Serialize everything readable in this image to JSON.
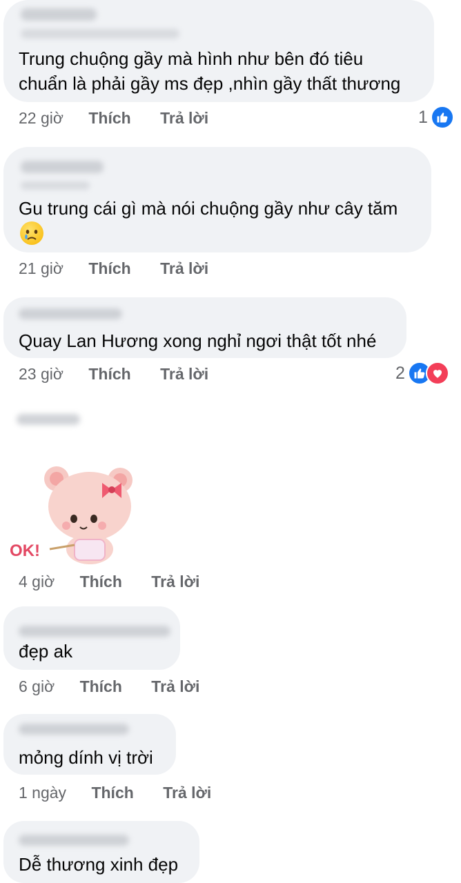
{
  "comments": [
    {
      "text_lines": [
        "Trung chuộng gầy mà hình như bên đó tiêu",
        "chuẩn là phải gầy ms đẹp ,nhìn gầy thất thương"
      ],
      "time": "22 giờ",
      "like_label": "Thích",
      "reply_label": "Trả lời",
      "reaction_count": "1",
      "reactions": [
        "like-icon"
      ]
    },
    {
      "text_lines": [
        "Gu trung cái gì mà nói chuộng gầy như cây tăm"
      ],
      "emoji": "crying-face-emoji",
      "time": "21 giờ",
      "like_label": "Thích",
      "reply_label": "Trả lời"
    },
    {
      "text_lines": [
        "Quay Lan Hương xong nghỉ ngơi thật tốt nhé"
      ],
      "time": "23 giờ",
      "like_label": "Thích",
      "reply_label": "Trả lời",
      "reaction_count": "2",
      "reactions": [
        "like-icon",
        "love-icon"
      ]
    },
    {
      "sticker": "pink-bear-ok-sticker",
      "sticker_text": "OK!",
      "time": "4 giờ",
      "like_label": "Thích",
      "reply_label": "Trả lời"
    },
    {
      "text_lines": [
        "đẹp ak"
      ],
      "time": "6 giờ",
      "like_label": "Thích",
      "reply_label": "Trả lời"
    },
    {
      "text_lines": [
        "mỏng dính vị trời"
      ],
      "time": "1 ngày",
      "like_label": "Thích",
      "reply_label": "Trả lời"
    },
    {
      "text_lines": [
        "Dễ thương xinh đẹp"
      ]
    }
  ],
  "colors": {
    "bubble": "#f0f2f5",
    "like": "#1877f2",
    "love": "#f33e58",
    "meta": "#65676b"
  }
}
